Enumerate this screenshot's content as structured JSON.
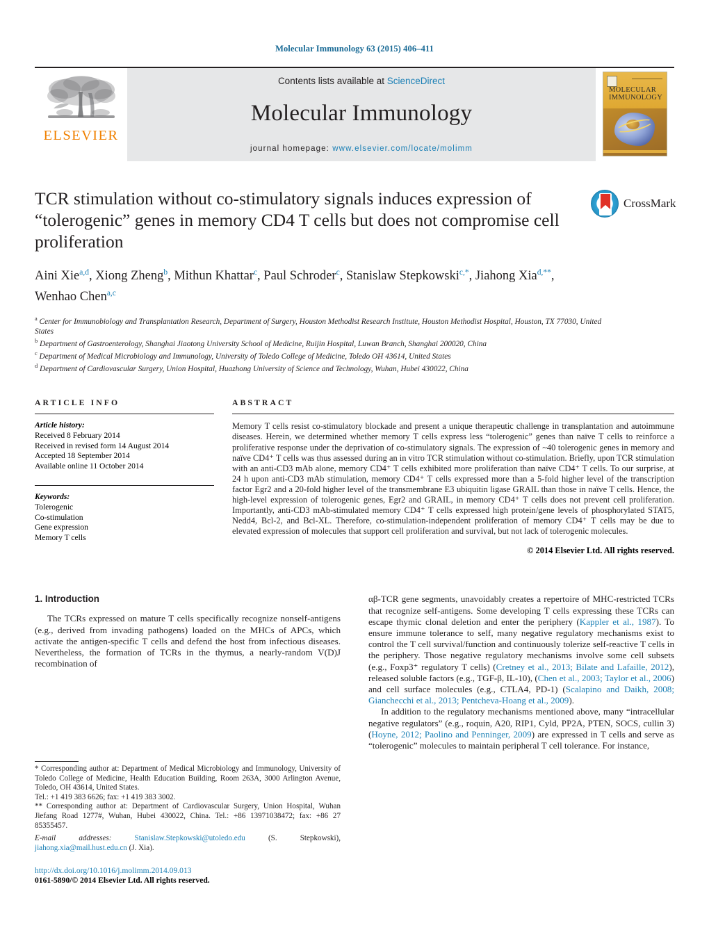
{
  "running_head": "Molecular Immunology 63 (2015) 406–411",
  "masthead": {
    "publisher_logo_label": "ELSEVIER",
    "contents_prefix": "Contents lists available at ",
    "contents_link": "ScienceDirect",
    "journal_name": "Molecular Immunology",
    "homepage_prefix": "journal homepage: ",
    "homepage_url": "www.elsevier.com/locate/molimm",
    "cover_title_line1": "MOLECULAR",
    "cover_title_line2": "IMMUNOLOGY"
  },
  "article": {
    "title": "TCR stimulation without co-stimulatory signals induces expression of “tolerogenic” genes in memory CD4 T cells but does not compromise cell proliferation",
    "crossmark_label": "CrossMark",
    "authors_html": "Aini Xie<sup>a,d</sup>, Xiong Zheng<sup>b</sup>, Mithun Khattar<sup>c</sup>, Paul Schroder<sup>c</sup>, Stanislaw Stepkowski<sup>c,</sup><sup>*</sup>, Jiahong Xia<sup>d,</sup><sup>**</sup>, Wenhao Chen<sup>a,c</sup>",
    "affiliations": [
      {
        "marker": "a",
        "text": "Center for Immunobiology and Transplantation Research, Department of Surgery, Houston Methodist Research Institute, Houston Methodist Hospital, Houston, TX 77030, United States"
      },
      {
        "marker": "b",
        "text": "Department of Gastroenterology, Shanghai Jiaotong University School of Medicine, Ruijin Hospital, Luwan Branch, Shanghai 200020, China"
      },
      {
        "marker": "c",
        "text": "Department of Medical Microbiology and Immunology, University of Toledo College of Medicine, Toledo OH 43614, United States"
      },
      {
        "marker": "d",
        "text": "Department of Cardiovascular Surgery, Union Hospital, Huazhong University of Science and Technology, Wuhan, Hubei 430022, China"
      }
    ]
  },
  "article_info": {
    "label": "ARTICLE INFO",
    "history_head": "Article history:",
    "history": [
      "Received 8 February 2014",
      "Received in revised form 14 August 2014",
      "Accepted 18 September 2014",
      "Available online 11 October 2014"
    ],
    "keywords_head": "Keywords:",
    "keywords": [
      "Tolerogenic",
      "Co-stimulation",
      "Gene expression",
      "Memory T cells"
    ]
  },
  "abstract": {
    "label": "ABSTRACT",
    "text": "Memory T cells resist co-stimulatory blockade and present a unique therapeutic challenge in transplantation and autoimmune diseases. Herein, we determined whether memory T cells express less “tolerogenic” genes than naïve T cells to reinforce a proliferative response under the deprivation of co-stimulatory signals. The expression of ~40 tolerogenic genes in memory and naïve CD4⁺ T cells was thus assessed during an in vitro TCR stimulation without co-stimulation. Briefly, upon TCR stimulation with an anti-CD3 mAb alone, memory CD4⁺ T cells exhibited more proliferation than naïve CD4⁺ T cells. To our surprise, at 24 h upon anti-CD3 mAb stimulation, memory CD4⁺ T cells expressed more than a 5-fold higher level of the transcription factor Egr2 and a 20-fold higher level of the transmembrane E3 ubiquitin ligase GRAIL than those in naïve T cells. Hence, the high-level expression of tolerogenic genes, Egr2 and GRAIL, in memory CD4⁺ T cells does not prevent cell proliferation. Importantly, anti-CD3 mAb-stimulated memory CD4⁺ T cells expressed high protein/gene levels of phosphorylated STAT5, Nedd4, Bcl-2, and Bcl-XL. Therefore, co-stimulation-independent proliferation of memory CD4⁺ T cells may be due to elevated expression of molecules that support cell proliferation and survival, but not lack of tolerogenic molecules.",
    "copyright": "© 2014 Elsevier Ltd. All rights reserved."
  },
  "introduction": {
    "heading": "1. Introduction",
    "left_paragraph": "The TCRs expressed on mature T cells specifically recognize nonself-antigens (e.g., derived from invading pathogens) loaded on the MHCs of APCs, which activate the antigen-specific T cells and defend the host from infectious diseases. Nevertheless, the formation of TCRs in the thymus, a nearly-random V(D)J recombination of",
    "right_paragraph_1_parts": [
      {
        "t": "αβ-TCR gene segments, unavoidably creates a repertoire of MHC-restricted TCRs that recognize self-antigens. Some developing T cells expressing these TCRs can escape thymic clonal deletion and enter the periphery (",
        "link": false
      },
      {
        "t": "Kappler et al., 1987",
        "link": true
      },
      {
        "t": "). To ensure immune tolerance to self, many negative regulatory mechanisms exist to control the T cell survival/function and continuously tolerize self-reactive T cells in the periphery. Those negative regulatory mechanisms involve some cell subsets (e.g., Foxp3⁺ regulatory T cells) (",
        "link": false
      },
      {
        "t": "Cretney et al., 2013; Bilate and Lafaille, 2012",
        "link": true
      },
      {
        "t": "), released soluble factors (e.g., TGF-β, IL-10), (",
        "link": false
      },
      {
        "t": "Chen et al., 2003; Taylor et al., 2006",
        "link": true
      },
      {
        "t": ") and cell surface molecules (e.g., CTLA4, PD-1) (",
        "link": false
      },
      {
        "t": "Scalapino and Daikh, 2008; Gianchecchi et al., 2013; Pentcheva-Hoang et al., 2009",
        "link": true
      },
      {
        "t": ").",
        "link": false
      }
    ],
    "right_paragraph_2_parts": [
      {
        "t": "In addition to the regulatory mechanisms mentioned above, many “intracellular negative regulators” (e.g., roquin, A20, RIP1, Cyld, PP2A, PTEN, SOCS, cullin 3) (",
        "link": false
      },
      {
        "t": "Hoyne, 2012; Paolino and Penninger, 2009",
        "link": true
      },
      {
        "t": ") are expressed in T cells and serve as “tolerogenic” molecules to maintain peripheral T cell tolerance. For instance,",
        "link": false
      }
    ]
  },
  "footnotes": {
    "corr1_parts": [
      {
        "t": "* Corresponding author at: Department of Medical Microbiology and Immunology, University of Toledo College of Medicine, Health Education Building, Room 263A, 3000 Arlington Avenue, Toledo, OH 43614, United States.",
        "link": false
      }
    ],
    "corr1_tel": "Tel.: +1 419 383 6626; fax: +1 419 383 3002.",
    "corr2": "** Corresponding author at: Department of Cardiovascular Surgery, Union Hospital, Wuhan Jiefang Road 1277#, Wuhan, Hubei 430022, China. Tel.: +86 13971038472; fax: +86 27 85355457.",
    "email_label": "E-mail addresses:",
    "email1": "Stanislaw.Stepkowski@utoledo.edu",
    "email1_name": " (S. Stepkowski),",
    "email2": "jiahong.xia@mail.hust.edu.cn",
    "email2_name": " (J. Xia).",
    "doi": "http://dx.doi.org/10.1016/j.molimm.2014.09.013",
    "issn": "0161-5890/© 2014 Elsevier Ltd. All rights reserved."
  },
  "colors": {
    "link": "#1a7fb5",
    "running_head": "#1a6b96",
    "elsevier_orange": "#f08000",
    "masthead_bg": "#e6e7e8"
  }
}
